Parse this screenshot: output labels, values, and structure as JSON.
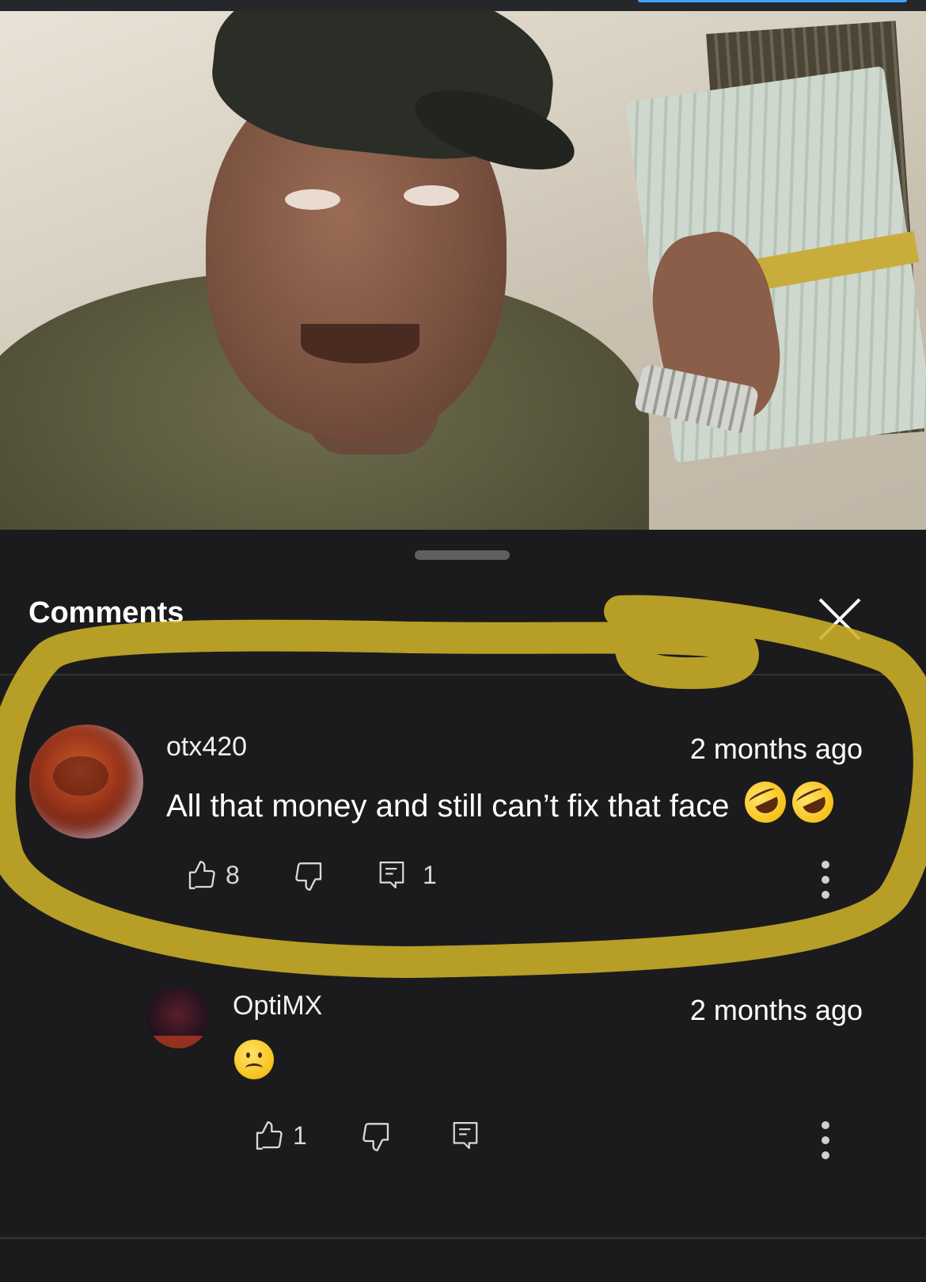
{
  "video": {
    "icon": "video-thumbnail"
  },
  "comments_panel": {
    "title": "Comments",
    "close_icon": "close-icon"
  },
  "comments": [
    {
      "author": "otx420",
      "time": "2 months ago",
      "text": "All that money and still can’t fix that face",
      "emojis": [
        "rolling-on-floor-laughing",
        "rolling-on-floor-laughing"
      ],
      "likes": "8",
      "replies": "1"
    }
  ],
  "replies": [
    {
      "author": "OptiMX",
      "time": "2 months ago",
      "emojis": [
        "frowning-face"
      ],
      "likes": "1"
    }
  ],
  "colors": {
    "background": "#1b1b1d",
    "highlight_marker": "#cdb128",
    "accent": "#3ea6ff"
  }
}
